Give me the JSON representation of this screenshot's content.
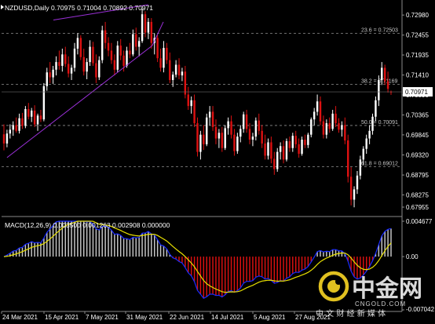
{
  "chart_data": [
    {
      "type": "candlestick",
      "header": "NZDUSD,Daily  0.70975 0.71004 0.70892 0.70971",
      "symbol": "NZDUSD",
      "timeframe": "Daily",
      "ohlc_current": [
        0.70975,
        0.71004,
        0.70892,
        0.70971
      ],
      "current_price": "0.70971",
      "ylim": [
        0.6775,
        0.7325
      ],
      "y_ticks": [
        "0.72980",
        "0.72455",
        "0.71935",
        "0.71410",
        "0.70890",
        "0.70365",
        "0.69845",
        "0.69320",
        "0.68795",
        "0.68275",
        "0.67955"
      ],
      "x_ticks": [
        "24 Mar 2021",
        "15 Apr 2021",
        "7 May 2021",
        "31 May 2021",
        "22 Jun 2021",
        "14 Jul 2021",
        "5 Aug 2021",
        "27 Aug 2021"
      ],
      "fibonacci": [
        {
          "label": "23.6 = 0.72503",
          "value": 0.72503
        },
        {
          "label": "38.2 = 0.71169",
          "value": 0.71169
        },
        {
          "label": "50.0 = 0.70091",
          "value": 0.70091
        },
        {
          "label": "61.8 = 0.69012",
          "value": 0.69012
        }
      ],
      "candles": [
        {
          "o": 0.6986,
          "h": 0.7012,
          "l": 0.6944,
          "c": 0.6962
        },
        {
          "o": 0.6962,
          "h": 0.6998,
          "l": 0.6952,
          "c": 0.6988
        },
        {
          "o": 0.6988,
          "h": 0.7012,
          "l": 0.6975,
          "c": 0.6998
        },
        {
          "o": 0.6998,
          "h": 0.702,
          "l": 0.6982,
          "c": 0.701
        },
        {
          "o": 0.701,
          "h": 0.703,
          "l": 0.699,
          "c": 0.6995
        },
        {
          "o": 0.6995,
          "h": 0.704,
          "l": 0.6988,
          "c": 0.7028
        },
        {
          "o": 0.7028,
          "h": 0.7042,
          "l": 0.7,
          "c": 0.7008
        },
        {
          "o": 0.7008,
          "h": 0.706,
          "l": 0.7002,
          "c": 0.7052
        },
        {
          "o": 0.7052,
          "h": 0.7068,
          "l": 0.7025,
          "c": 0.7032
        },
        {
          "o": 0.7032,
          "h": 0.7055,
          "l": 0.7018,
          "c": 0.7048
        },
        {
          "o": 0.7048,
          "h": 0.7062,
          "l": 0.7005,
          "c": 0.7012
        },
        {
          "o": 0.7012,
          "h": 0.704,
          "l": 0.6995,
          "c": 0.7035
        },
        {
          "o": 0.7035,
          "h": 0.705,
          "l": 0.7018,
          "c": 0.7025
        },
        {
          "o": 0.7025,
          "h": 0.712,
          "l": 0.702,
          "c": 0.7112
        },
        {
          "o": 0.7112,
          "h": 0.716,
          "l": 0.71,
          "c": 0.7148
        },
        {
          "o": 0.7148,
          "h": 0.7175,
          "l": 0.712,
          "c": 0.7135
        },
        {
          "o": 0.7135,
          "h": 0.7165,
          "l": 0.7118,
          "c": 0.7155
        },
        {
          "o": 0.7155,
          "h": 0.719,
          "l": 0.714,
          "c": 0.7175
        },
        {
          "o": 0.7175,
          "h": 0.7205,
          "l": 0.7155,
          "c": 0.7165
        },
        {
          "o": 0.7165,
          "h": 0.721,
          "l": 0.715,
          "c": 0.7195
        },
        {
          "o": 0.7195,
          "h": 0.7215,
          "l": 0.7162,
          "c": 0.717
        },
        {
          "o": 0.717,
          "h": 0.719,
          "l": 0.7135,
          "c": 0.7145
        },
        {
          "o": 0.7145,
          "h": 0.7168,
          "l": 0.7128,
          "c": 0.716
        },
        {
          "o": 0.716,
          "h": 0.7225,
          "l": 0.715,
          "c": 0.721
        },
        {
          "o": 0.721,
          "h": 0.725,
          "l": 0.7195,
          "c": 0.7238
        },
        {
          "o": 0.7238,
          "h": 0.7245,
          "l": 0.718,
          "c": 0.7188
        },
        {
          "o": 0.7188,
          "h": 0.721,
          "l": 0.714,
          "c": 0.715
        },
        {
          "o": 0.715,
          "h": 0.7185,
          "l": 0.713,
          "c": 0.7175
        },
        {
          "o": 0.7175,
          "h": 0.7232,
          "l": 0.7165,
          "c": 0.7215
        },
        {
          "o": 0.7215,
          "h": 0.7228,
          "l": 0.7165,
          "c": 0.7172
        },
        {
          "o": 0.7172,
          "h": 0.7195,
          "l": 0.712,
          "c": 0.7135
        },
        {
          "o": 0.7135,
          "h": 0.719,
          "l": 0.7128,
          "c": 0.718
        },
        {
          "o": 0.718,
          "h": 0.727,
          "l": 0.7172,
          "c": 0.7258
        },
        {
          "o": 0.7258,
          "h": 0.728,
          "l": 0.721,
          "c": 0.7225
        },
        {
          "o": 0.7225,
          "h": 0.724,
          "l": 0.719,
          "c": 0.7205
        },
        {
          "o": 0.7205,
          "h": 0.7225,
          "l": 0.717,
          "c": 0.718
        },
        {
          "o": 0.718,
          "h": 0.7195,
          "l": 0.714,
          "c": 0.7155
        },
        {
          "o": 0.7155,
          "h": 0.723,
          "l": 0.7148,
          "c": 0.7218
        },
        {
          "o": 0.7218,
          "h": 0.7235,
          "l": 0.718,
          "c": 0.7192
        },
        {
          "o": 0.7192,
          "h": 0.7205,
          "l": 0.715,
          "c": 0.7165
        },
        {
          "o": 0.7165,
          "h": 0.7215,
          "l": 0.716,
          "c": 0.7205
        },
        {
          "o": 0.7205,
          "h": 0.7225,
          "l": 0.7185,
          "c": 0.7195
        },
        {
          "o": 0.7195,
          "h": 0.726,
          "l": 0.719,
          "c": 0.7248
        },
        {
          "o": 0.7248,
          "h": 0.7265,
          "l": 0.7205,
          "c": 0.7215
        },
        {
          "o": 0.7215,
          "h": 0.724,
          "l": 0.719,
          "c": 0.723
        },
        {
          "o": 0.723,
          "h": 0.7315,
          "l": 0.7225,
          "c": 0.73
        },
        {
          "o": 0.73,
          "h": 0.7308,
          "l": 0.724,
          "c": 0.7252
        },
        {
          "o": 0.7252,
          "h": 0.729,
          "l": 0.7235,
          "c": 0.728
        },
        {
          "o": 0.728,
          "h": 0.729,
          "l": 0.721,
          "c": 0.7225
        },
        {
          "o": 0.7225,
          "h": 0.725,
          "l": 0.7195,
          "c": 0.7238
        },
        {
          "o": 0.7238,
          "h": 0.7245,
          "l": 0.7175,
          "c": 0.7185
        },
        {
          "o": 0.7185,
          "h": 0.721,
          "l": 0.715,
          "c": 0.716
        },
        {
          "o": 0.716,
          "h": 0.723,
          "l": 0.7148,
          "c": 0.7212
        },
        {
          "o": 0.7212,
          "h": 0.7225,
          "l": 0.717,
          "c": 0.718
        },
        {
          "o": 0.718,
          "h": 0.72,
          "l": 0.712,
          "c": 0.7128
        },
        {
          "o": 0.7128,
          "h": 0.715,
          "l": 0.711,
          "c": 0.7142
        },
        {
          "o": 0.7142,
          "h": 0.718,
          "l": 0.7135,
          "c": 0.7168
        },
        {
          "o": 0.7168,
          "h": 0.7185,
          "l": 0.713,
          "c": 0.714
        },
        {
          "o": 0.714,
          "h": 0.716,
          "l": 0.7125,
          "c": 0.715
        },
        {
          "o": 0.715,
          "h": 0.7165,
          "l": 0.708,
          "c": 0.709
        },
        {
          "o": 0.709,
          "h": 0.711,
          "l": 0.705,
          "c": 0.706
        },
        {
          "o": 0.706,
          "h": 0.7085,
          "l": 0.704,
          "c": 0.7075
        },
        {
          "o": 0.7075,
          "h": 0.709,
          "l": 0.7005,
          "c": 0.7015
        },
        {
          "o": 0.7015,
          "h": 0.703,
          "l": 0.6928,
          "c": 0.694
        },
        {
          "o": 0.694,
          "h": 0.6995,
          "l": 0.692,
          "c": 0.6985
        },
        {
          "o": 0.6985,
          "h": 0.701,
          "l": 0.6945,
          "c": 0.696
        },
        {
          "o": 0.696,
          "h": 0.704,
          "l": 0.6955,
          "c": 0.703
        },
        {
          "o": 0.703,
          "h": 0.706,
          "l": 0.701,
          "c": 0.7045
        },
        {
          "o": 0.7045,
          "h": 0.706,
          "l": 0.6995,
          "c": 0.7005
        },
        {
          "o": 0.7005,
          "h": 0.7025,
          "l": 0.696,
          "c": 0.6975
        },
        {
          "o": 0.6975,
          "h": 0.7,
          "l": 0.695,
          "c": 0.699
        },
        {
          "o": 0.699,
          "h": 0.7005,
          "l": 0.694,
          "c": 0.695
        },
        {
          "o": 0.695,
          "h": 0.701,
          "l": 0.6945,
          "c": 0.7002
        },
        {
          "o": 0.7002,
          "h": 0.703,
          "l": 0.6985,
          "c": 0.702
        },
        {
          "o": 0.702,
          "h": 0.7035,
          "l": 0.6975,
          "c": 0.6985
        },
        {
          "o": 0.6985,
          "h": 0.7,
          "l": 0.693,
          "c": 0.6942
        },
        {
          "o": 0.6942,
          "h": 0.699,
          "l": 0.6935,
          "c": 0.698
        },
        {
          "o": 0.698,
          "h": 0.701,
          "l": 0.6965,
          "c": 0.7
        },
        {
          "o": 0.7,
          "h": 0.7045,
          "l": 0.699,
          "c": 0.7038
        },
        {
          "o": 0.7038,
          "h": 0.705,
          "l": 0.699,
          "c": 0.7
        },
        {
          "o": 0.7,
          "h": 0.7015,
          "l": 0.696,
          "c": 0.6972
        },
        {
          "o": 0.6972,
          "h": 0.699,
          "l": 0.6955,
          "c": 0.698
        },
        {
          "o": 0.698,
          "h": 0.703,
          "l": 0.697,
          "c": 0.7022
        },
        {
          "o": 0.7022,
          "h": 0.704,
          "l": 0.6985,
          "c": 0.6995
        },
        {
          "o": 0.6995,
          "h": 0.701,
          "l": 0.695,
          "c": 0.6962
        },
        {
          "o": 0.6962,
          "h": 0.6985,
          "l": 0.692,
          "c": 0.693
        },
        {
          "o": 0.693,
          "h": 0.6975,
          "l": 0.692,
          "c": 0.6965
        },
        {
          "o": 0.6965,
          "h": 0.698,
          "l": 0.691,
          "c": 0.6922
        },
        {
          "o": 0.6922,
          "h": 0.694,
          "l": 0.688,
          "c": 0.6895
        },
        {
          "o": 0.6895,
          "h": 0.695,
          "l": 0.6888,
          "c": 0.694
        },
        {
          "o": 0.694,
          "h": 0.6965,
          "l": 0.692,
          "c": 0.6955
        },
        {
          "o": 0.6955,
          "h": 0.697,
          "l": 0.691,
          "c": 0.692
        },
        {
          "o": 0.692,
          "h": 0.6975,
          "l": 0.6915,
          "c": 0.6968
        },
        {
          "o": 0.6968,
          "h": 0.698,
          "l": 0.694,
          "c": 0.695
        },
        {
          "o": 0.695,
          "h": 0.699,
          "l": 0.694,
          "c": 0.6982
        },
        {
          "o": 0.6982,
          "h": 0.6995,
          "l": 0.695,
          "c": 0.696
        },
        {
          "o": 0.696,
          "h": 0.6975,
          "l": 0.6925,
          "c": 0.6935
        },
        {
          "o": 0.6935,
          "h": 0.698,
          "l": 0.693,
          "c": 0.6972
        },
        {
          "o": 0.6972,
          "h": 0.6985,
          "l": 0.695,
          "c": 0.6958
        },
        {
          "o": 0.6958,
          "h": 0.699,
          "l": 0.695,
          "c": 0.6985
        },
        {
          "o": 0.6985,
          "h": 0.703,
          "l": 0.6978,
          "c": 0.7025
        },
        {
          "o": 0.7025,
          "h": 0.7055,
          "l": 0.701,
          "c": 0.7045
        },
        {
          "o": 0.7045,
          "h": 0.709,
          "l": 0.7035,
          "c": 0.7072
        },
        {
          "o": 0.7072,
          "h": 0.7085,
          "l": 0.701,
          "c": 0.702
        },
        {
          "o": 0.702,
          "h": 0.7035,
          "l": 0.6975,
          "c": 0.6985
        },
        {
          "o": 0.6985,
          "h": 0.7025,
          "l": 0.6975,
          "c": 0.7015
        },
        {
          "o": 0.7015,
          "h": 0.703,
          "l": 0.699,
          "c": 0.7
        },
        {
          "o": 0.7,
          "h": 0.705,
          "l": 0.6995,
          "c": 0.704
        },
        {
          "o": 0.704,
          "h": 0.706,
          "l": 0.7005,
          "c": 0.7015
        },
        {
          "o": 0.7015,
          "h": 0.7028,
          "l": 0.699,
          "c": 0.6998
        },
        {
          "o": 0.6998,
          "h": 0.702,
          "l": 0.698,
          "c": 0.701
        },
        {
          "o": 0.701,
          "h": 0.703,
          "l": 0.696,
          "c": 0.697
        },
        {
          "o": 0.697,
          "h": 0.6985,
          "l": 0.686,
          "c": 0.6875
        },
        {
          "o": 0.6875,
          "h": 0.69,
          "l": 0.68,
          "c": 0.6815
        },
        {
          "o": 0.6815,
          "h": 0.685,
          "l": 0.6795,
          "c": 0.6842
        },
        {
          "o": 0.6842,
          "h": 0.689,
          "l": 0.683,
          "c": 0.6878
        },
        {
          "o": 0.6878,
          "h": 0.693,
          "l": 0.6868,
          "c": 0.692
        },
        {
          "o": 0.692,
          "h": 0.6955,
          "l": 0.6905,
          "c": 0.6948
        },
        {
          "o": 0.6948,
          "h": 0.6985,
          "l": 0.6935,
          "c": 0.6975
        },
        {
          "o": 0.6975,
          "h": 0.701,
          "l": 0.696,
          "c": 0.6995
        },
        {
          "o": 0.6995,
          "h": 0.704,
          "l": 0.6985,
          "c": 0.7032
        },
        {
          "o": 0.7032,
          "h": 0.7085,
          "l": 0.702,
          "c": 0.7075
        },
        {
          "o": 0.7075,
          "h": 0.714,
          "l": 0.706,
          "c": 0.7128
        },
        {
          "o": 0.7128,
          "h": 0.7175,
          "l": 0.7115,
          "c": 0.716
        },
        {
          "o": 0.716,
          "h": 0.7168,
          "l": 0.7115,
          "c": 0.7125
        },
        {
          "o": 0.7125,
          "h": 0.715,
          "l": 0.7095,
          "c": 0.7105
        },
        {
          "o": 0.70975,
          "h": 0.71004,
          "l": 0.70892,
          "c": 0.70971
        }
      ],
      "trendlines_color": "#9b30d9",
      "colors": {
        "background": "#000000",
        "bull": "#ffffff",
        "bear": "#dd1111",
        "grid": "#505050",
        "text": "#ffffff",
        "fib": "#909090"
      }
    },
    {
      "type": "macd",
      "label": "MACD(12,26,9)  0.003500 0.001263 0.002908 0.000000",
      "params": "12,26,9",
      "values": [
        0.0035,
        0.001263,
        0.002908,
        0.0
      ],
      "ylim": [
        -0.007042,
        0.004677
      ],
      "y_ticks": [
        "0.004677",
        "0.00",
        "-0.007042"
      ],
      "colors": {
        "positive_hist": "#c8c8c8",
        "negative_hist": "#dd1111",
        "main_line": "#1a2cff",
        "signal_line": "#e8e000"
      }
    }
  ],
  "watermark": {
    "brand": "中金网",
    "domain": "CNGOLD.COM",
    "tagline": "中 文 财 经 新 媒 体",
    "logo_color": "#e0c020"
  }
}
